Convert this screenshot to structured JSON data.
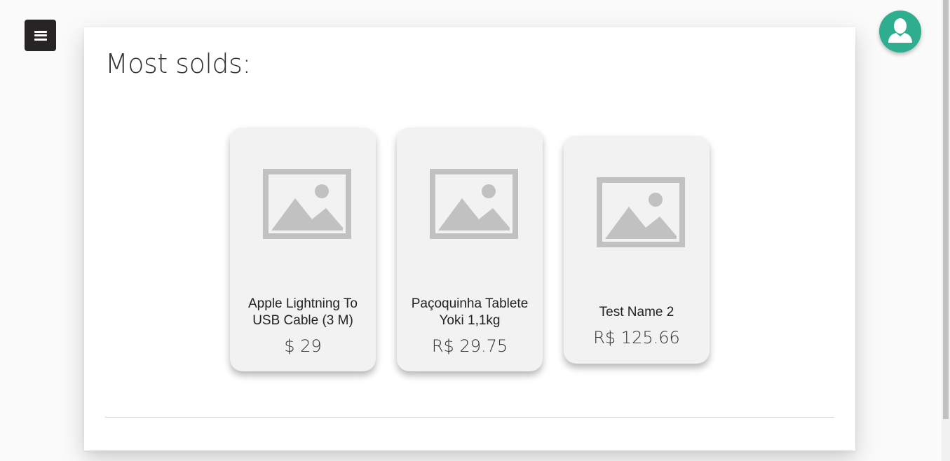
{
  "header": {
    "menu_icon": "hamburger-icon",
    "avatar_icon": "user-icon"
  },
  "section": {
    "title": "Most solds:"
  },
  "products": [
    {
      "name_line1": "Apple Lightning To",
      "name_line2": "USB Cable (3 M)",
      "price": "$ 29",
      "image_icon": "image-placeholder-icon"
    },
    {
      "name_line1": "Paçoquinha Tablete",
      "name_line2": "Yoki 1,1kg",
      "price": "R$ 29.75",
      "image_icon": "image-placeholder-icon"
    },
    {
      "name_line1": "Test Name 2",
      "name_line2": "",
      "price": "R$ 125.66",
      "image_icon": "image-placeholder-icon"
    }
  ],
  "colors": {
    "menu_button": "#262424",
    "avatar": "#2eae8f",
    "card_background": "#f2f2f2",
    "placeholder": "#c1c1c1"
  }
}
